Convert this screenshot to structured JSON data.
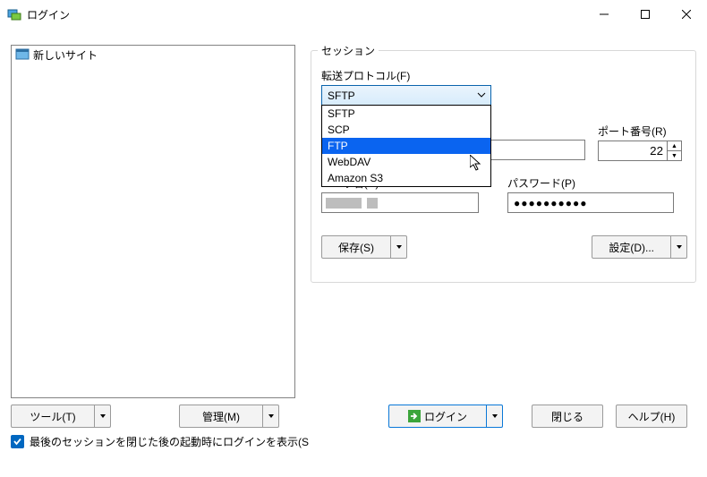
{
  "titlebar": {
    "title": "ログイン"
  },
  "tree": {
    "new_site": "新しいサイト"
  },
  "session": {
    "group_label": "セッション",
    "protocol_label": "転送プロトコル(F)",
    "protocol_value": "SFTP",
    "protocol_options": [
      "SFTP",
      "SCP",
      "FTP",
      "WebDAV",
      "Amazon S3"
    ],
    "highlighted_option_index": 2,
    "port_label": "ポート番号(R)",
    "port_value": "22",
    "user_label": "ユーザ名(U)",
    "password_label": "パスワード(P)",
    "password_mask": "●●●●●●●●●●",
    "save_label": "保存(S)",
    "settings_label": "設定(D)..."
  },
  "bottom": {
    "tools_label": "ツール(T)",
    "manage_label": "管理(M)",
    "login_label": "ログイン",
    "close_label": "閉じる",
    "help_label": "ヘルプ(H)",
    "checkbox_label": "最後のセッションを閉じた後の起動時にログインを表示(S",
    "checkbox_checked": true
  }
}
